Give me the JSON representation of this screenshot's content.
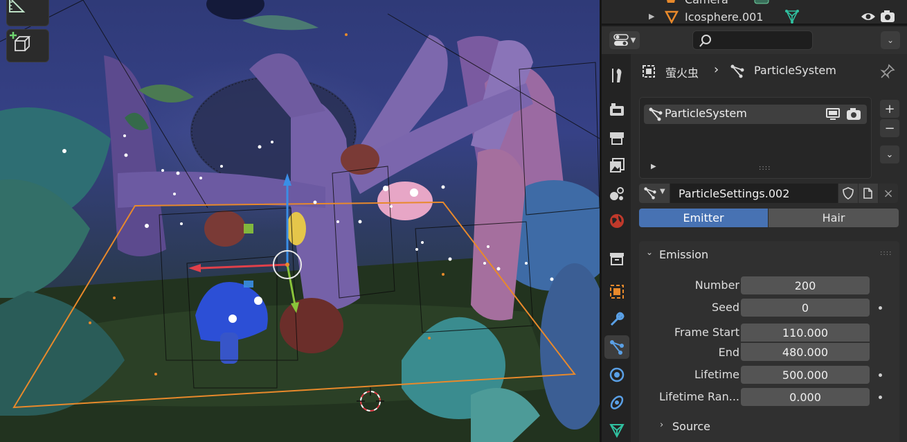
{
  "outliner": {
    "rows": [
      {
        "label": "Camera"
      },
      {
        "label": "Icosphere.001"
      }
    ]
  },
  "properties": {
    "search_placeholder": "",
    "breadcrumb": {
      "object": "萤火虫",
      "modifier": "ParticleSystem"
    },
    "particle_list": {
      "items": [
        {
          "label": "ParticleSystem"
        }
      ],
      "grip": "::::"
    },
    "settings": {
      "datablock": "ParticleSettings.002"
    },
    "type_tabs": {
      "active": "Emitter",
      "inactive": "Hair"
    },
    "emission": {
      "header": "Emission",
      "grip": "::::",
      "fields": [
        {
          "label": "Number",
          "value": "200"
        },
        {
          "label": "Seed",
          "value": "0"
        },
        {
          "label": "Frame Start",
          "value": "110.000"
        },
        {
          "label": "End",
          "value": "480.000"
        },
        {
          "label": "Lifetime",
          "value": "500.000"
        },
        {
          "label": "Lifetime Ran...",
          "value": "0.000"
        }
      ]
    },
    "source": {
      "header": "Source"
    }
  },
  "colors": {
    "accent": "#4772b3",
    "selection": "#e8892b",
    "axis_x": "#e0404a",
    "axis_y": "#8ac43a",
    "axis_z": "#3a8ee6"
  }
}
